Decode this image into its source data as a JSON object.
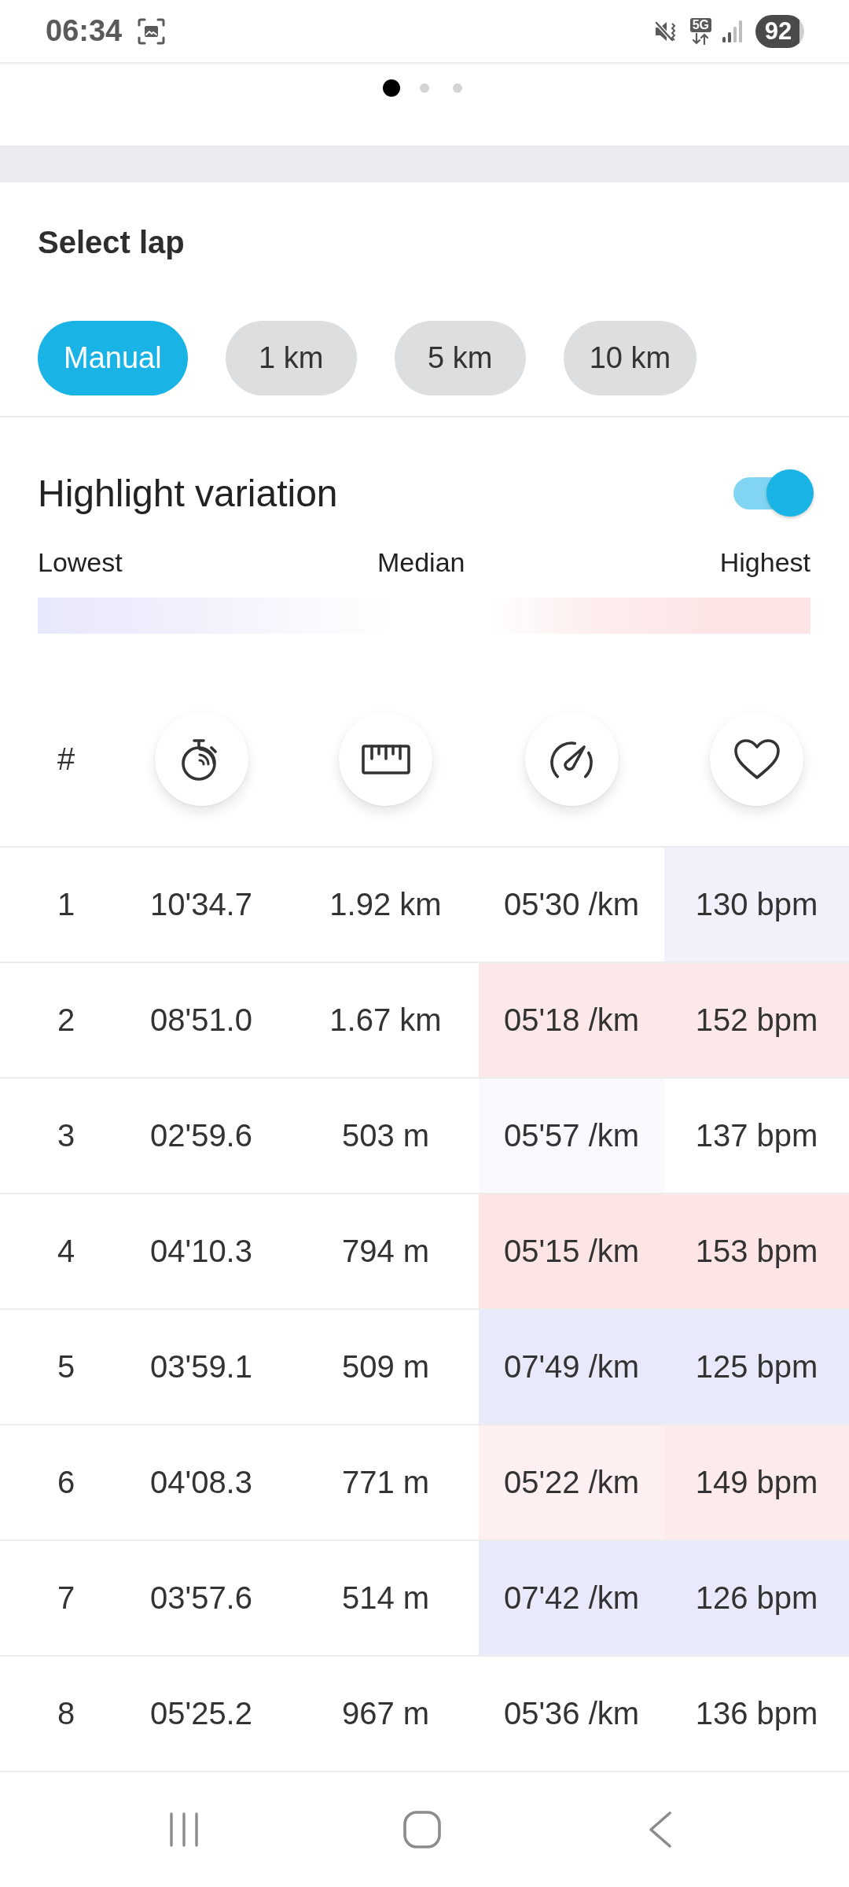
{
  "status_bar": {
    "time": "06:34",
    "network_type": "5G",
    "battery": "92"
  },
  "pager": {
    "dots": [
      {
        "selected": true
      },
      {
        "selected": false
      },
      {
        "selected": false
      }
    ]
  },
  "select_lap": {
    "title": "Select lap",
    "options": [
      {
        "label": "Manual",
        "selected": true
      },
      {
        "label": "1 km",
        "selected": false
      },
      {
        "label": "5 km",
        "selected": false
      },
      {
        "label": "10 km",
        "selected": false
      }
    ]
  },
  "highlight_variation": {
    "label": "Highlight variation",
    "on": true,
    "legend": [
      "Lowest",
      "Median",
      "Highest"
    ]
  },
  "laps_table": {
    "number_heading": "#",
    "rows": [
      {
        "number": "1",
        "cells": [
          {
            "text": "10'34.7"
          },
          {
            "text": "1.92 km"
          },
          {
            "text": "05'30 /km"
          },
          {
            "text": "130 bpm",
            "color": "#f1f1fc"
          }
        ]
      },
      {
        "number": "2",
        "cells": [
          {
            "text": "08'51.0"
          },
          {
            "text": "1.67 km"
          },
          {
            "text": "05'18 /km",
            "color": "#fde8e9"
          },
          {
            "text": "152 bpm",
            "color": "#fde8e9"
          }
        ]
      },
      {
        "number": "3",
        "cells": [
          {
            "text": "02'59.6"
          },
          {
            "text": "503 m"
          },
          {
            "text": "05'57 /km",
            "color": "#f9f9fe"
          },
          {
            "text": "137 bpm"
          }
        ]
      },
      {
        "number": "4",
        "cells": [
          {
            "text": "04'10.3"
          },
          {
            "text": "794 m"
          },
          {
            "text": "05'15 /km",
            "color": "#fde5e6"
          },
          {
            "text": "153 bpm",
            "color": "#fde5e6"
          }
        ]
      },
      {
        "number": "5",
        "cells": [
          {
            "text": "03'59.1"
          },
          {
            "text": "509 m"
          },
          {
            "text": "07'49 /km",
            "color": "#e9e9fc"
          },
          {
            "text": "125 bpm",
            "color": "#e9e9fc"
          }
        ]
      },
      {
        "number": "6",
        "cells": [
          {
            "text": "04'08.3"
          },
          {
            "text": "771 m"
          },
          {
            "text": "05'22 /km",
            "color": "#fef0f1"
          },
          {
            "text": "149 bpm",
            "color": "#fdeaeb"
          }
        ]
      },
      {
        "number": "7",
        "cells": [
          {
            "text": "03'57.6"
          },
          {
            "text": "514 m"
          },
          {
            "text": "07'42 /km",
            "color": "#e9e9fc"
          },
          {
            "text": "126 bpm",
            "color": "#e9e9fc"
          }
        ]
      },
      {
        "number": "8",
        "cells": [
          {
            "text": "05'25.2"
          },
          {
            "text": "967 m"
          },
          {
            "text": "05'36 /km"
          },
          {
            "text": "136 bpm"
          }
        ]
      }
    ]
  }
}
